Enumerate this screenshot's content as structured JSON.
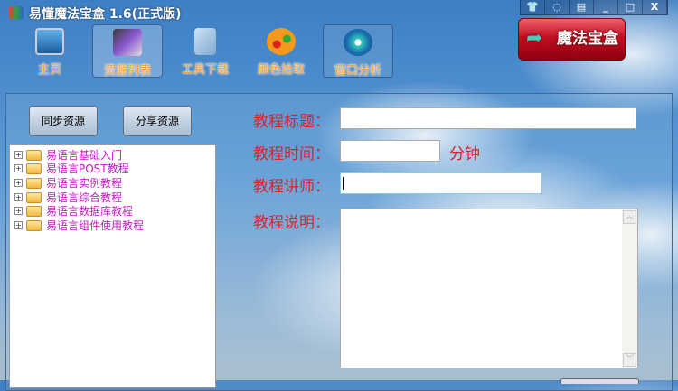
{
  "window": {
    "title": "易懂魔法宝盒 1.6(正式版)",
    "controls": [
      "skin",
      "feedback",
      "menu",
      "minimize",
      "maximize",
      "close"
    ]
  },
  "logo": {
    "text": "魔法宝盒"
  },
  "toolbar": [
    {
      "label": "主页",
      "icon": "monitor-icon"
    },
    {
      "label": "资源列表",
      "icon": "film-icon"
    },
    {
      "label": "工具下载",
      "icon": "tools-folder-icon"
    },
    {
      "label": "颜色拾取",
      "icon": "palette-icon"
    },
    {
      "label": "窗口分析",
      "icon": "windows-orb-icon"
    }
  ],
  "left": {
    "sync_button": "同步资源",
    "share_button": "分享资源",
    "tree": [
      "易语言基础入门",
      "易语言POST教程",
      "易语言实例教程",
      "易语言综合教程",
      "易语言数据库教程",
      "易语言组件使用教程"
    ]
  },
  "form": {
    "title_label": "教程标题：",
    "title_value": "",
    "time_label": "教程时间：",
    "time_value": "",
    "time_unit": "分钟",
    "teacher_label": "教程讲师：",
    "teacher_value": "",
    "desc_label": "教程说明：",
    "desc_value": ""
  },
  "colors": {
    "label": "#e0202a",
    "tree_text": "#c51dc5",
    "toolbar_text": "#f5a030"
  }
}
